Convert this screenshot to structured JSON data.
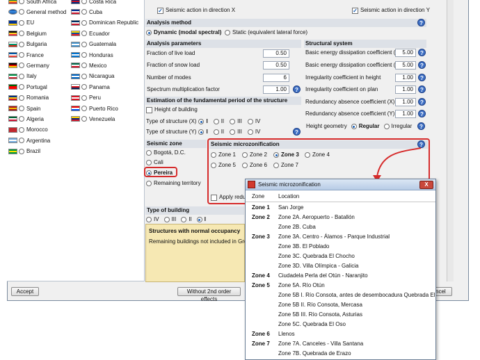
{
  "countries_left": [
    {
      "name": "South Africa",
      "flag": [
        "#007a4d",
        "#ffb612",
        "#de3831"
      ]
    },
    {
      "name": "General method",
      "flag": [
        "#1a5fb4",
        "#3b8ce0",
        "#1a5fb4"
      ],
      "globe": true
    },
    {
      "name": "EU",
      "flag": [
        "#003399",
        "#003399",
        "#ffcc00"
      ]
    },
    {
      "name": "Belgium",
      "flag": [
        "#000000",
        "#fdda24",
        "#ef3340"
      ]
    },
    {
      "name": "Bulgaria",
      "flag": [
        "#ffffff",
        "#00966e",
        "#d62612"
      ]
    },
    {
      "name": "France",
      "flag": [
        "#0055a4",
        "#ffffff",
        "#ef4135"
      ]
    },
    {
      "name": "Germany",
      "flag": [
        "#000000",
        "#dd0000",
        "#ffce00"
      ]
    },
    {
      "name": "Italy",
      "flag": [
        "#009246",
        "#ffffff",
        "#ce2b37"
      ]
    },
    {
      "name": "Portugal",
      "flag": [
        "#006600",
        "#ff0000",
        "#ff0000"
      ]
    },
    {
      "name": "Romania",
      "flag": [
        "#002b7f",
        "#fcd116",
        "#ce1126"
      ]
    },
    {
      "name": "Spain",
      "flag": [
        "#aa151b",
        "#f1bf00",
        "#aa151b"
      ]
    },
    {
      "name": "Algeria",
      "flag": [
        "#006233",
        "#ffffff",
        "#d21034"
      ]
    },
    {
      "name": "Morocco",
      "flag": [
        "#c1272d",
        "#c1272d",
        "#c1272d"
      ]
    },
    {
      "name": "Argentina",
      "flag": [
        "#74acdf",
        "#ffffff",
        "#74acdf"
      ]
    },
    {
      "name": "Brazil",
      "flag": [
        "#009c3b",
        "#ffdf00",
        "#009c3b"
      ]
    }
  ],
  "countries_right": [
    {
      "name": "Costa Rica",
      "flag": [
        "#002b7f",
        "#ce1126",
        "#002b7f"
      ]
    },
    {
      "name": "Cuba",
      "flag": [
        "#002a8f",
        "#ffffff",
        "#cf142b"
      ]
    },
    {
      "name": "Dominican Republic",
      "flag": [
        "#002d62",
        "#ffffff",
        "#ce1126"
      ]
    },
    {
      "name": "Ecuador",
      "flag": [
        "#ffdd00",
        "#034ea2",
        "#ed1c24"
      ]
    },
    {
      "name": "Guatemala",
      "flag": [
        "#4997d0",
        "#ffffff",
        "#4997d0"
      ]
    },
    {
      "name": "Honduras",
      "flag": [
        "#0073cf",
        "#ffffff",
        "#0073cf"
      ]
    },
    {
      "name": "Mexico",
      "flag": [
        "#006847",
        "#ffffff",
        "#ce1126"
      ]
    },
    {
      "name": "Nicaragua",
      "flag": [
        "#0067c6",
        "#ffffff",
        "#0067c6"
      ]
    },
    {
      "name": "Panama",
      "flag": [
        "#ffffff",
        "#da121a",
        "#072357"
      ]
    },
    {
      "name": "Peru",
      "flag": [
        "#d91023",
        "#ffffff",
        "#d91023"
      ]
    },
    {
      "name": "Puerto Rico",
      "flag": [
        "#ed0000",
        "#ffffff",
        "#0050f0"
      ]
    },
    {
      "name": "Venezuela",
      "flag": [
        "#ffcc00",
        "#00247d",
        "#cf142b"
      ]
    }
  ],
  "seismic_direction": {
    "x_label": "Seismic action in direction X",
    "y_label": "Seismic action in direction Y"
  },
  "analysis_method": {
    "title": "Analysis method",
    "dynamic": "Dynamic (modal spectral)",
    "static": "Static (equivalent lateral force)"
  },
  "analysis_parameters": {
    "title": "Analysis parameters",
    "rows": [
      {
        "label": "Fraction of live load",
        "value": "0.50"
      },
      {
        "label": "Fraction of snow load",
        "value": "0.50"
      },
      {
        "label": "Number of modes",
        "value": "6"
      },
      {
        "label": "Spectrum multiplication factor",
        "value": "1.00"
      }
    ]
  },
  "structural_system": {
    "title": "Structural system",
    "rows": [
      {
        "label": "Basic energy dissipation coefficient (X)",
        "value": "5.00"
      },
      {
        "label": "Basic energy dissipation coefficient (Y)",
        "value": "5.00"
      },
      {
        "label": "Irregularity coefficient in height",
        "value": "1.00"
      },
      {
        "label": "Irregularity coefficient on plan",
        "value": "1.00"
      },
      {
        "label": "Redundancy absence coefficient (X)",
        "value": "1.00"
      },
      {
        "label": "Redundancy absence coefficient (Y)",
        "value": "1.00"
      }
    ],
    "height_geometry_label": "Height geometry",
    "regular": "Regular",
    "irregular": "Irregular"
  },
  "fundamental_period": {
    "title": "Estimation of the fundamental period of the structure",
    "height_of_building": "Height of building",
    "type_x_label": "Type of structure (X)",
    "type_y_label": "Type of structure (Y)",
    "options": [
      "I",
      "II",
      "III",
      "IV"
    ]
  },
  "seismic_zone": {
    "title": "Seismic zone",
    "options": [
      "Bogotá, D.C.",
      "Cali",
      "Pereira",
      "Remaining territory"
    ]
  },
  "microzonification": {
    "title": "Seismic microzonification",
    "zones": [
      "Zone 1",
      "Zone 2",
      "Zone 3",
      "Zone 4",
      "Zone 5",
      "Zone 6",
      "Zone 7"
    ],
    "apply_label": "Apply reduct"
  },
  "type_of_building": {
    "title": "Type of building",
    "options": [
      "IV",
      "III",
      "II",
      "I"
    ],
    "note_title": "Structures with normal occupancy",
    "note_text": "Remaining buildings not included in Groups"
  },
  "buttons": {
    "accept": "Accept",
    "without_2nd": "Without 2nd order effects",
    "cancel": "ncel"
  },
  "popup": {
    "title": "Seismic microzonification",
    "close": "X",
    "col_zone": "Zone",
    "col_location": "Location",
    "rows": [
      {
        "zone": "Zone 1",
        "location": "San Jorge"
      },
      {
        "zone": "Zone 2",
        "location": "Zone 2A. Aeropuerto - Batallón"
      },
      {
        "zone": "",
        "location": "Zone 2B. Cuba"
      },
      {
        "zone": "Zone 3",
        "location": "Zone 3A. Centro - Álamos - Parque Industrial"
      },
      {
        "zone": "",
        "location": "Zone 3B. El Poblado"
      },
      {
        "zone": "",
        "location": "Zone 3C. Quebrada El Chocho"
      },
      {
        "zone": "",
        "location": "Zone 3D. Villa Olímpica - Galicia"
      },
      {
        "zone": "Zone 4",
        "location": "Ciudadela Perla del Otún - Naranjito"
      },
      {
        "zone": "Zone 5",
        "location": "Zone 5A. Río Otún"
      },
      {
        "zone": "",
        "location": "Zone 5B I. Río Consota, antes de desembocadura Quebrada El Oso"
      },
      {
        "zone": "",
        "location": "Zone 5B II. Río Consota, Mercasa"
      },
      {
        "zone": "",
        "location": "Zone 5B III. Río Consota, Asturias"
      },
      {
        "zone": "",
        "location": "Zone 5C. Quebrada El Oso"
      },
      {
        "zone": "Zone 6",
        "location": "Llenos"
      },
      {
        "zone": "Zone 7",
        "location": "Zone 7A. Canceles - Villa Santana"
      },
      {
        "zone": "",
        "location": "Zone 7B. Quebrada de Erazo"
      }
    ]
  },
  "colors": {
    "highlight": "#d62b2b",
    "section_bg": "#dde1e7",
    "note_bg": "#f6e8b3",
    "accent": "#1a5fb4"
  },
  "icons": {
    "help": "?",
    "checkmark": "✓"
  }
}
